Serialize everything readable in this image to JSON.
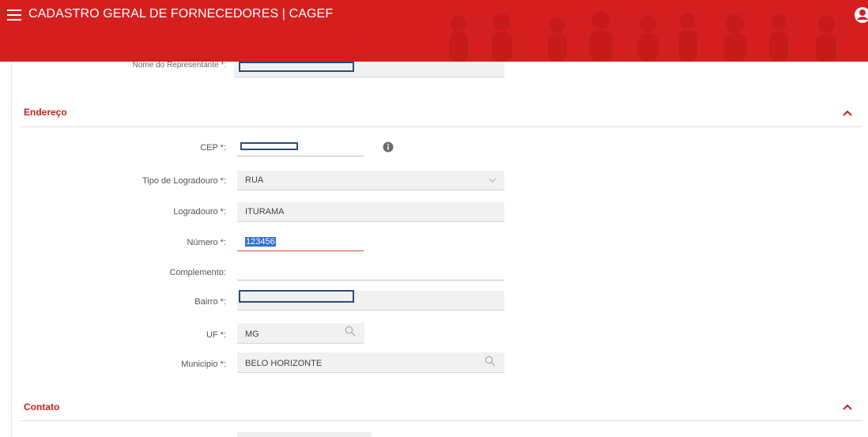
{
  "header": {
    "title": "CADASTRO GERAL DE FORNECEDORES | CAGEF",
    "accent_color": "#d51f1f"
  },
  "representante": {
    "label": "Nome do Representante *:"
  },
  "endereco": {
    "section_title": "Endereço",
    "cep": {
      "label": "CEP *:"
    },
    "tipo_logradouro": {
      "label": "Tipo de Logradouro *:",
      "value": "RUA"
    },
    "logradouro": {
      "label": "Logradouro *:",
      "value": "ITURAMA"
    },
    "numero": {
      "label": "Número *:",
      "value": "123456"
    },
    "complemento": {
      "label": "Complemento:",
      "value": ""
    },
    "bairro": {
      "label": "Bairro *:"
    },
    "uf": {
      "label": "UF *:",
      "value": "MG"
    },
    "municipio": {
      "label": "Municipio *:",
      "value": "BELO HORIZONTE"
    }
  },
  "contato": {
    "section_title": "Contato"
  },
  "icons": {
    "menu": "hamburger-menu-icon",
    "user": "user-account-icon",
    "info": "info-icon",
    "search": "search-icon",
    "collapse": "chevron-up-icon",
    "dropdown": "caret-down-icon"
  }
}
